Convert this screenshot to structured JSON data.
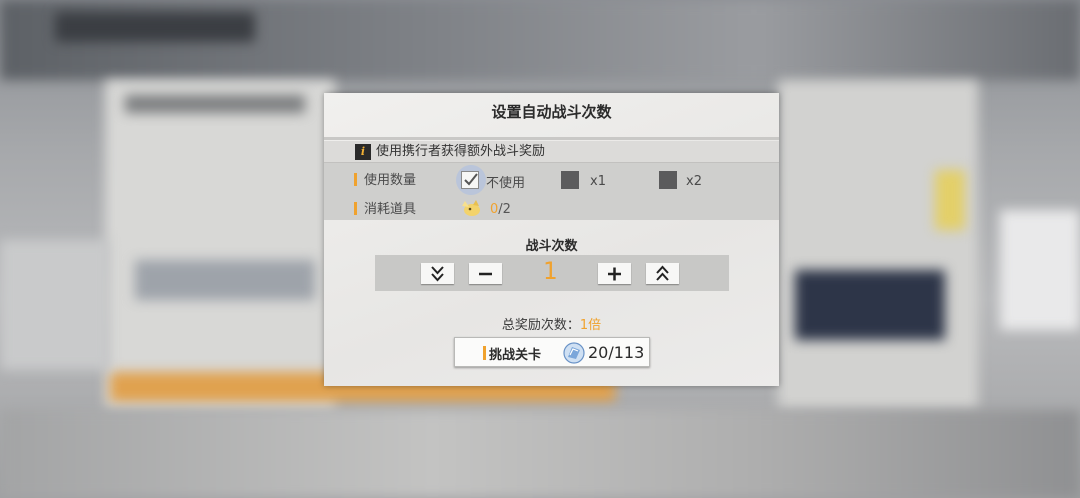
{
  "dialog": {
    "title": "设置自动战斗次数",
    "info_text": "使用携行者获得额外战斗奖励",
    "info_icon": "info-icon",
    "usage_label": "使用数量",
    "options": [
      {
        "label": "不使用",
        "checked": true
      },
      {
        "label": "x1",
        "checked": false
      },
      {
        "label": "x2",
        "checked": false
      }
    ],
    "consume_label": "消耗道具",
    "consume_current": "0",
    "consume_total": "/2",
    "battle_count_title": "战斗次数",
    "battle_count_value": "1",
    "reward_label": "总奖励次数：",
    "reward_multiplier": "1倍",
    "challenge_label": "挑战关卡",
    "stamina_value": "20/113"
  },
  "colors": {
    "accent": "#f0a22e",
    "dialog_bg": "#ecebea",
    "band_bg": "#cfcfcd",
    "checkbox_off": "#5b5b5c"
  }
}
